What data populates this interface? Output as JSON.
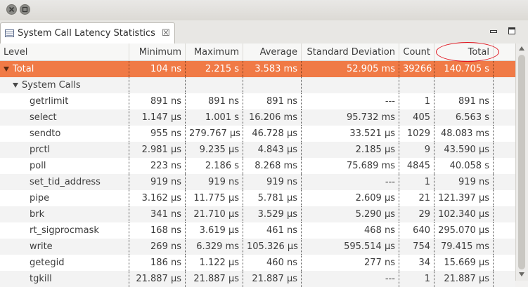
{
  "view": {
    "tab_title": "System Call Latency Statistics",
    "tab_close_glyph": "☒"
  },
  "columns": [
    {
      "label": "Level"
    },
    {
      "label": "Minimum"
    },
    {
      "label": "Maximum"
    },
    {
      "label": "Average"
    },
    {
      "label": "Standard Deviation"
    },
    {
      "label": "Count"
    },
    {
      "label": "Total"
    }
  ],
  "rows": [
    {
      "level": "Total",
      "depth": 0,
      "expanded": true,
      "selected": true,
      "min": "104 ns",
      "max": "2.215 s",
      "avg": "3.583 ms",
      "std": "52.905 ms",
      "count": "39266",
      "total": "140.705 s"
    },
    {
      "level": "System Calls",
      "depth": 1,
      "expanded": true,
      "selected": false,
      "min": "",
      "max": "",
      "avg": "",
      "std": "",
      "count": "",
      "total": ""
    },
    {
      "level": "getrlimit",
      "depth": 2,
      "min": "891 ns",
      "max": "891 ns",
      "avg": "891 ns",
      "std": "---",
      "count": "1",
      "total": "891 ns"
    },
    {
      "level": "select",
      "depth": 2,
      "min": "1.147 µs",
      "max": "1.001 s",
      "avg": "16.206 ms",
      "std": "95.732 ms",
      "count": "405",
      "total": "6.563 s"
    },
    {
      "level": "sendto",
      "depth": 2,
      "min": "955 ns",
      "max": "279.767 µs",
      "avg": "46.728 µs",
      "std": "33.521 µs",
      "count": "1029",
      "total": "48.083 ms"
    },
    {
      "level": "prctl",
      "depth": 2,
      "min": "2.981 µs",
      "max": "9.235 µs",
      "avg": "4.843 µs",
      "std": "2.185 µs",
      "count": "9",
      "total": "43.590 µs"
    },
    {
      "level": "poll",
      "depth": 2,
      "min": "223 ns",
      "max": "2.186 s",
      "avg": "8.268 ms",
      "std": "75.689 ms",
      "count": "4845",
      "total": "40.058 s"
    },
    {
      "level": "set_tid_address",
      "depth": 2,
      "min": "919 ns",
      "max": "919 ns",
      "avg": "919 ns",
      "std": "---",
      "count": "1",
      "total": "919 ns"
    },
    {
      "level": "pipe",
      "depth": 2,
      "min": "3.162 µs",
      "max": "11.775 µs",
      "avg": "5.781 µs",
      "std": "2.609 µs",
      "count": "21",
      "total": "121.397 µs"
    },
    {
      "level": "brk",
      "depth": 2,
      "min": "341 ns",
      "max": "21.710 µs",
      "avg": "3.529 µs",
      "std": "5.290 µs",
      "count": "29",
      "total": "102.340 µs"
    },
    {
      "level": "rt_sigprocmask",
      "depth": 2,
      "min": "168 ns",
      "max": "3.619 µs",
      "avg": "461 ns",
      "std": "468 ns",
      "count": "640",
      "total": "295.070 µs"
    },
    {
      "level": "write",
      "depth": 2,
      "min": "269 ns",
      "max": "6.329 ms",
      "avg": "105.326 µs",
      "std": "595.514 µs",
      "count": "754",
      "total": "79.415 ms"
    },
    {
      "level": "getegid",
      "depth": 2,
      "min": "186 ns",
      "max": "1.122 µs",
      "avg": "460 ns",
      "std": "277 ns",
      "count": "34",
      "total": "15.669 µs"
    },
    {
      "level": "tgkill",
      "depth": 2,
      "min": "21.887 µs",
      "max": "21.887 µs",
      "avg": "21.887 µs",
      "std": "---",
      "count": "1",
      "total": "21.887 µs"
    }
  ],
  "colors": {
    "selection": "#f07a46",
    "annotation": "#e0141e"
  }
}
